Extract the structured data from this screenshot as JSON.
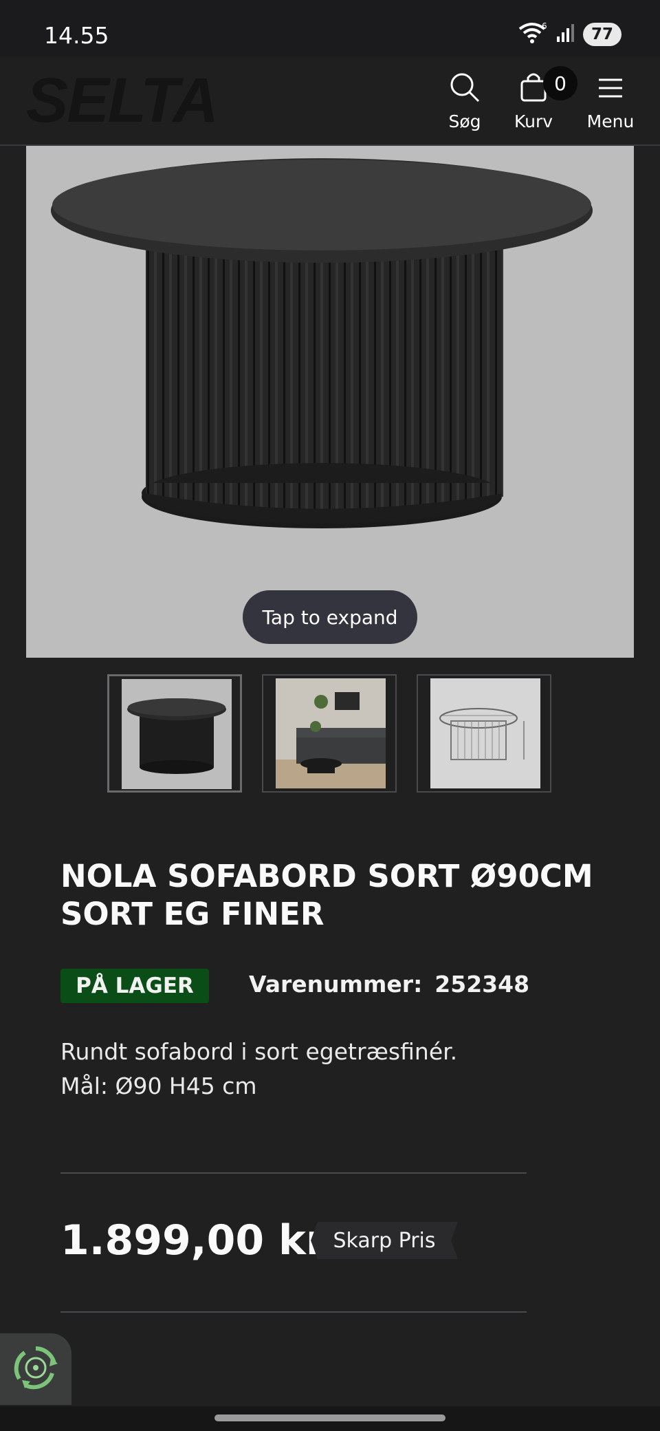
{
  "status_bar": {
    "time": "14.55",
    "battery": "77",
    "wifi_badge": "6"
  },
  "header": {
    "logo": "SELTA",
    "search_label": "Søg",
    "cart_label": "Kurv",
    "cart_count": "0",
    "menu_label": "Menu"
  },
  "gallery": {
    "expand_label": "Tap to expand"
  },
  "product": {
    "title": "NOLA SOFABORD SORT Ø90CM SORT EG FINER",
    "stock_status": "PÅ LAGER",
    "sku_label": "Varenummer:",
    "sku_value": "252348",
    "description_line1": "Rundt sofabord i sort egetræsfinér.",
    "description_line2": "Mål: Ø90 H45 cm",
    "price": "1.899,00 kr.",
    "price_tag": "Skarp Pris"
  },
  "colors": {
    "background": "#202021",
    "stock_green": "#0b4d16",
    "image_bg": "#bdbdbd",
    "eco_green": "#7cc47a"
  },
  "icons": [
    "search-icon",
    "cart-icon",
    "hamburger-menu-icon",
    "wifi-icon",
    "signal-icon",
    "battery-icon",
    "recycle-icon"
  ]
}
